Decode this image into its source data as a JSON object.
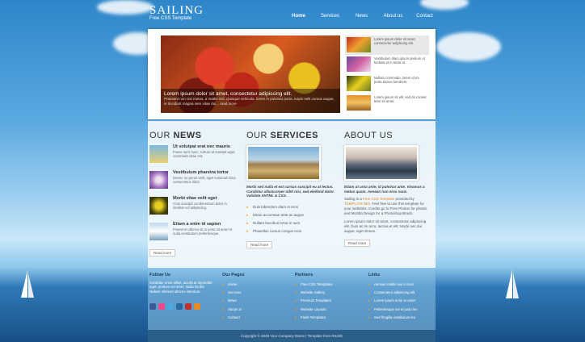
{
  "header": {
    "logo_title": "SAILING",
    "logo_sub": "Free CSS Template",
    "nav": [
      "Home",
      "Services",
      "News",
      "About us",
      "Contact"
    ]
  },
  "slider": {
    "caption_title": "Lorem ipsum dolor sit amet, consectetur adipiscing elit.",
    "caption_text": "Praesent non nisi metus, a mattis nisl. Quisque vehicula, lorem in pulvinar porta, turpis velit cursus augue, in tincidunt magna sem vitae dui... read more",
    "thumbs": [
      {
        "text": "Lorem ipsum dolor sit amet, consectetur adipiscing elit."
      },
      {
        "text": "Vestibulum diam ipsum pretium ut facilisis et in tortor id."
      },
      {
        "text": "Nullam commodo, lorem id mi porta lacinia hendrerit."
      },
      {
        "text": "Lorem ipsum sit elit, sed do consec tetur sit amet."
      }
    ]
  },
  "news": {
    "heading_light": "OUR",
    "heading_bold": "NEWS",
    "items": [
      {
        "title": "Ut volutpat erat nec mauris",
        "text": "Fusce sem nunc, rutrum at suscipit eget, commodo vitae est."
      },
      {
        "title": "Vestibulum pharetra tortor",
        "text": "Donec eu purus velit, eget euismod risus consectetur dolor."
      },
      {
        "title": "Morbi vitae velit eget",
        "text": "Cras suscipit condimentum dolor in facilisis vel adipiscing."
      },
      {
        "title": "Etiam a enim id sapien",
        "text": "Praesent ultrices sit iu justo sit amet et nulla vestibulum pellentesque."
      }
    ],
    "button": "Read more"
  },
  "services": {
    "heading_light": "OUR",
    "heading_bold": "SERVICES",
    "intro": "Morbi sed nulla et est cursus suscipit eu at lectus. Curabitur ullamcorper nibh nisi, sed eleifend dolor. Validate XHTML & CSS.",
    "list": [
      "Duis bibendum diam et eros",
      "Etiam accumsan ante ac augue",
      "Nullam faucibus tortor in sem",
      "Phasellus cursus congue eros"
    ],
    "button": "Read more"
  },
  "about": {
    "heading": "ABOUT US",
    "intro": "Etiam ut urna ante, id pulvinar ante. Vivamus a metus quam. Aenean non eros nunc.",
    "p1_a": "Sailing is a ",
    "p1_link": "Free CSS Template",
    "p1_b": " provided by ",
    "p1_link2": "TEMPLATE MO",
    "p1_c": ". Feel free to use this template for your websites. Credits go to Free Photos for photos and Mozilla Design for a Photoshop Brush.",
    "p2": "Lorem ipsum dolor sit amet, consectetur adipiscing elit. Duis ac mi arcu, lacinia et elit. Morbi nec dui augue, eget dictum.",
    "button": "Read more"
  },
  "footer": {
    "follow_title": "Follow Us",
    "follow_text": "Curabitur enim tellus, iaculis at imperdiet eget, pretium vel amet. Nulla facilisi. Nullam eleifend ultrices interdum.",
    "pages_title": "Our Pages",
    "pages": [
      "Home",
      "Services",
      "News",
      "About us",
      "Contact"
    ],
    "partners_title": "Partners",
    "partners": [
      "Free CSS Templates",
      "Website Gallery",
      "Premium Templates",
      "Website Layouts",
      "Flash Templates"
    ],
    "links_title": "Links",
    "links": [
      "Aenean mattis nisi a risus",
      "Consectetur adipiscing elit",
      "Lorem ipsum enim et amet",
      "Pellentesque vel et justo leo",
      "Sed fringilla vestibulum leo"
    ],
    "copyright": "Copyright © 2048 Your Company Name | Template from RIUSE"
  },
  "colors": {
    "accent": "#e67e22",
    "sky": "#5aa8e0",
    "sea": "#174f86"
  }
}
